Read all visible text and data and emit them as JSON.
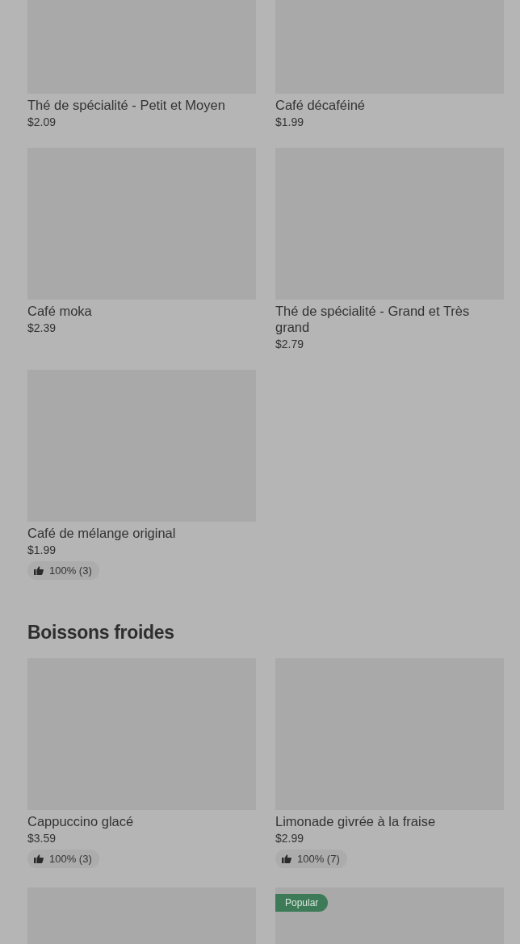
{
  "sections": [
    {
      "items": [
        {
          "kind": "product",
          "name": "Thé de spécialité - Petit et Moyen",
          "price": "$2.09"
        },
        {
          "kind": "product",
          "name": "Café décaféiné",
          "price": "$1.99"
        },
        {
          "kind": "product",
          "name": "Café moka",
          "price": "$2.39"
        },
        {
          "kind": "product",
          "name": "Thé de spécialité - Grand et Très grand",
          "price": "$2.79"
        },
        {
          "kind": "product",
          "name": "Café de mélange original",
          "price": "$1.99",
          "rating": "100% (3)"
        }
      ]
    },
    {
      "title": "Boissons froides",
      "items": [
        {
          "kind": "product",
          "name": "Cappuccino glacé",
          "price": "$3.59",
          "rating": "100% (3)"
        },
        {
          "kind": "product",
          "name": "Limonade givrée à la fraise",
          "price": "$2.99",
          "rating": "100% (7)"
        },
        {
          "kind": "picture"
        },
        {
          "kind": "picture",
          "badge": "Popular"
        }
      ]
    }
  ]
}
